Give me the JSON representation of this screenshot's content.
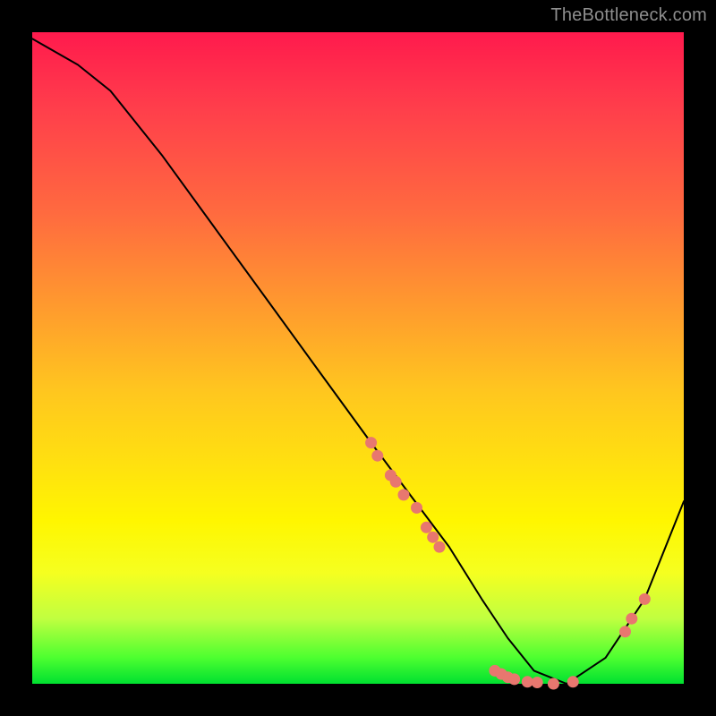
{
  "watermark": "TheBottleneck.com",
  "chart_data": {
    "type": "line",
    "title": "",
    "xlabel": "",
    "ylabel": "",
    "xlim": [
      0,
      100
    ],
    "ylim": [
      0,
      100
    ],
    "series": [
      {
        "name": "curve",
        "x": [
          0,
          7,
          12,
          20,
          28,
          36,
          44,
          52,
          58,
          64,
          69,
          73,
          77,
          82,
          88,
          94,
          100
        ],
        "y": [
          99,
          95,
          91,
          81,
          70,
          59,
          48,
          37,
          29,
          21,
          13,
          7,
          2,
          0,
          4,
          13,
          28
        ],
        "stroke": "#000000",
        "stroke_width": 2
      }
    ],
    "markers": [
      {
        "x": 52,
        "y": 37
      },
      {
        "x": 53,
        "y": 35
      },
      {
        "x": 55,
        "y": 32
      },
      {
        "x": 55.8,
        "y": 31
      },
      {
        "x": 57,
        "y": 29
      },
      {
        "x": 59,
        "y": 27
      },
      {
        "x": 60.5,
        "y": 24
      },
      {
        "x": 61.5,
        "y": 22.5
      },
      {
        "x": 62.5,
        "y": 21
      },
      {
        "x": 71,
        "y": 2
      },
      {
        "x": 72,
        "y": 1.5
      },
      {
        "x": 73,
        "y": 1
      },
      {
        "x": 74,
        "y": 0.7
      },
      {
        "x": 76,
        "y": 0.3
      },
      {
        "x": 77.5,
        "y": 0.2
      },
      {
        "x": 80,
        "y": 0
      },
      {
        "x": 83,
        "y": 0.3
      },
      {
        "x": 91,
        "y": 8
      },
      {
        "x": 92,
        "y": 10
      },
      {
        "x": 94,
        "y": 13
      }
    ],
    "marker_style": {
      "fill": "#e8776f",
      "stroke": "#e8776f",
      "radius_px": 6
    }
  }
}
